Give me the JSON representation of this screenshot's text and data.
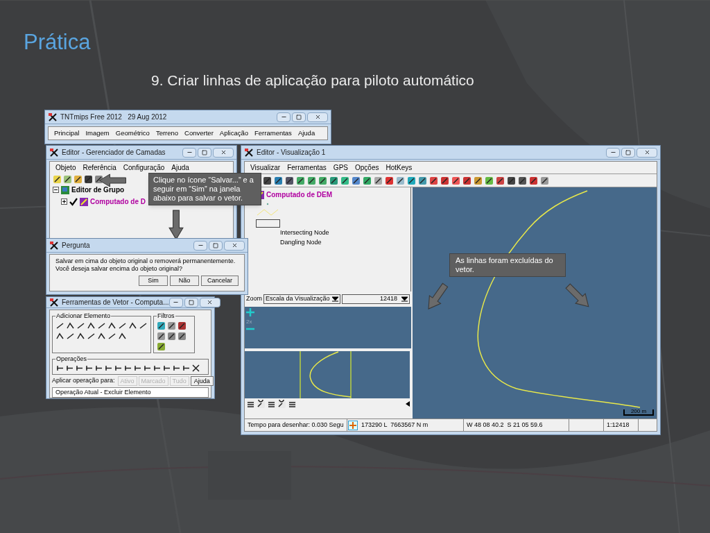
{
  "slide": {
    "title": "Prática",
    "subtitle": "9. Criar linhas de aplicação para piloto automático"
  },
  "main_window": {
    "title": "TNTmips Free 2012   29 Aug 2012",
    "menu": [
      "Principal",
      "Imagem",
      "Geométrico",
      "Terreno",
      "Converter",
      "Aplicação",
      "Ferramentas",
      "Ajuda"
    ]
  },
  "layer_manager": {
    "title": "Editor - Gerenciador de Camadas",
    "menu": [
      "Objeto",
      "Referência",
      "Configuração",
      "Ajuda"
    ],
    "tree": [
      {
        "label": "Editor de Grupo",
        "expanded": true,
        "children": [
          {
            "label": "Computado de D",
            "expanded": false,
            "checked": true
          }
        ]
      }
    ]
  },
  "callout": "Clique no ícone “Salvar...” e a seguir em “Sim” na janela abaixo para salvar o vetor.",
  "dialog": {
    "title": "Pergunta",
    "message": [
      "Salvar em cima do objeto original o removerá permanentemente.",
      "Você deseja salvar encima do objeto original?"
    ],
    "buttons": [
      "Sim",
      "Não",
      "Cancelar"
    ]
  },
  "vector_tools": {
    "title": "Ferramentas de Vetor - Computa...",
    "groups": [
      "Adicionar Elemento",
      "Filtros",
      "Operações"
    ],
    "apply_label": "Aplicar operação para:",
    "apply_buttons": [
      {
        "label": "Ativo",
        "disabled": true
      },
      {
        "label": "Marcado",
        "disabled": true
      },
      {
        "label": "Tudo",
        "disabled": true
      },
      {
        "label": "Ajuda",
        "disabled": false
      }
    ],
    "status": "Operação Atual - Excluir Elemento"
  },
  "view_window": {
    "title": "Editor - Visualização 1",
    "menu": [
      "Visualizar",
      "Ferramentas",
      "GPS",
      "Opções",
      "HotKeys"
    ],
    "legend": {
      "layer": "Computado de DEM",
      "nodes": [
        "Intersecting Node",
        "Dangling Node"
      ]
    },
    "zoom": {
      "label": "Zoom",
      "mode": "Escala da Visualização",
      "value": "12418",
      "factor": "2x"
    },
    "scale_bar": "200 m",
    "status": [
      "Tempo para desenhar: 0.030 Segu",
      "173290 L  7663567 N m",
      "W 48 08 40.2  S 21 05 59.6",
      "1:12418"
    ]
  },
  "annotation": "As linhas foram excluídas do vetor."
}
